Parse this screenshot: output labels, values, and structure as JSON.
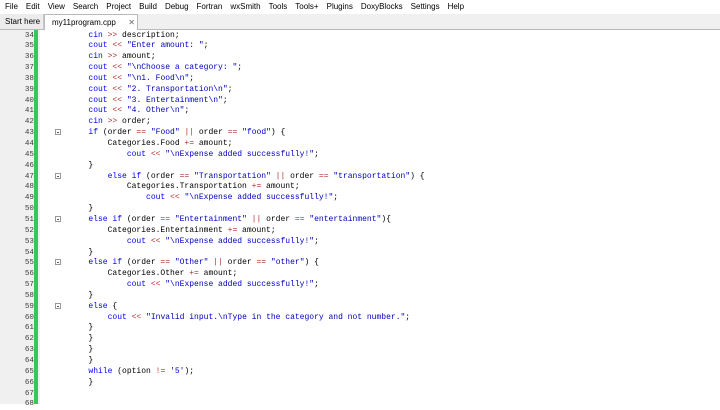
{
  "menu": [
    "File",
    "Edit",
    "View",
    "Search",
    "Project",
    "Build",
    "Debug",
    "Fortran",
    "wxSmith",
    "Tools",
    "Tools+",
    "Plugins",
    "DoxyBlocks",
    "Settings",
    "Help"
  ],
  "tabs": [
    {
      "label": "Start here",
      "active": false
    },
    {
      "label": "my11program.cpp",
      "active": true
    }
  ],
  "colors": {
    "keyword": "#0000ff",
    "string": "#0000c0",
    "operator": "#b03030",
    "changed_bar": "#34c759"
  },
  "icons": {
    "tab_close": "close-icon",
    "fold": "fold-marker-icon"
  },
  "code": [
    {
      "n": "34",
      "fold": false,
      "segs": [
        [
          "p",
          "        "
        ],
        [
          "k",
          "cin"
        ],
        [
          "p",
          " "
        ],
        [
          "o",
          ">>"
        ],
        [
          "p",
          " description;"
        ]
      ]
    },
    {
      "n": "35",
      "fold": false,
      "segs": [
        [
          "p",
          "        "
        ],
        [
          "k",
          "cout"
        ],
        [
          "p",
          " "
        ],
        [
          "o",
          "<<"
        ],
        [
          "p",
          " "
        ],
        [
          "s",
          "\"Enter amount: \""
        ],
        [
          "p",
          ";"
        ]
      ]
    },
    {
      "n": "36",
      "fold": false,
      "segs": [
        [
          "p",
          "        "
        ],
        [
          "k",
          "cin"
        ],
        [
          "p",
          " "
        ],
        [
          "o",
          ">>"
        ],
        [
          "p",
          " amount;"
        ]
      ]
    },
    {
      "n": "37",
      "fold": false,
      "segs": [
        [
          "p",
          "        "
        ],
        [
          "k",
          "cout"
        ],
        [
          "p",
          " "
        ],
        [
          "o",
          "<<"
        ],
        [
          "p",
          " "
        ],
        [
          "s",
          "\"\\nChoose a category: \""
        ],
        [
          "p",
          ";"
        ]
      ]
    },
    {
      "n": "38",
      "fold": false,
      "segs": [
        [
          "p",
          "        "
        ],
        [
          "k",
          "cout"
        ],
        [
          "p",
          " "
        ],
        [
          "o",
          "<<"
        ],
        [
          "p",
          " "
        ],
        [
          "s",
          "\"\\n1. Food\\n\""
        ],
        [
          "p",
          ";"
        ]
      ]
    },
    {
      "n": "39",
      "fold": false,
      "segs": [
        [
          "p",
          "        "
        ],
        [
          "k",
          "cout"
        ],
        [
          "p",
          " "
        ],
        [
          "o",
          "<<"
        ],
        [
          "p",
          " "
        ],
        [
          "s",
          "\"2. Transportation\\n\""
        ],
        [
          "p",
          ";"
        ]
      ]
    },
    {
      "n": "40",
      "fold": false,
      "segs": [
        [
          "p",
          "        "
        ],
        [
          "k",
          "cout"
        ],
        [
          "p",
          " "
        ],
        [
          "o",
          "<<"
        ],
        [
          "p",
          " "
        ],
        [
          "s",
          "\"3. Entertainment\\n\""
        ],
        [
          "p",
          ";"
        ]
      ]
    },
    {
      "n": "41",
      "fold": false,
      "segs": [
        [
          "p",
          "        "
        ],
        [
          "k",
          "cout"
        ],
        [
          "p",
          " "
        ],
        [
          "o",
          "<<"
        ],
        [
          "p",
          " "
        ],
        [
          "s",
          "\"4. Other\\n\""
        ],
        [
          "p",
          ";"
        ]
      ]
    },
    {
      "n": "42",
      "fold": false,
      "segs": [
        [
          "p",
          "        "
        ],
        [
          "k",
          "cin"
        ],
        [
          "p",
          " "
        ],
        [
          "o",
          ">>"
        ],
        [
          "p",
          " order;"
        ]
      ]
    },
    {
      "n": "43",
      "fold": true,
      "segs": [
        [
          "p",
          "        "
        ],
        [
          "k",
          "if"
        ],
        [
          "p",
          " (order "
        ],
        [
          "o",
          "=="
        ],
        [
          "p",
          " "
        ],
        [
          "s",
          "\"Food\""
        ],
        [
          "p",
          " "
        ],
        [
          "o",
          "||"
        ],
        [
          "p",
          " order "
        ],
        [
          "o",
          "=="
        ],
        [
          "p",
          " "
        ],
        [
          "s",
          "\"food\""
        ],
        [
          "p",
          ") {"
        ]
      ]
    },
    {
      "n": "44",
      "fold": false,
      "segs": [
        [
          "p",
          "            Categories.Food "
        ],
        [
          "o",
          "+="
        ],
        [
          "p",
          " amount;"
        ]
      ]
    },
    {
      "n": "45",
      "fold": false,
      "segs": [
        [
          "p",
          "                "
        ],
        [
          "k",
          "cout"
        ],
        [
          "p",
          " "
        ],
        [
          "o",
          "<<"
        ],
        [
          "p",
          " "
        ],
        [
          "s",
          "\"\\nExpense added successfully!\""
        ],
        [
          "p",
          ";"
        ]
      ]
    },
    {
      "n": "46",
      "fold": false,
      "segs": [
        [
          "p",
          "        }"
        ]
      ]
    },
    {
      "n": "47",
      "fold": true,
      "segs": [
        [
          "p",
          "            "
        ],
        [
          "k",
          "else if"
        ],
        [
          "p",
          " (order "
        ],
        [
          "o",
          "=="
        ],
        [
          "p",
          " "
        ],
        [
          "s",
          "\"Transportation\""
        ],
        [
          "p",
          " "
        ],
        [
          "o",
          "||"
        ],
        [
          "p",
          " order "
        ],
        [
          "o",
          "=="
        ],
        [
          "p",
          " "
        ],
        [
          "s",
          "\"transportation\""
        ],
        [
          "p",
          ") {"
        ]
      ]
    },
    {
      "n": "48",
      "fold": false,
      "segs": [
        [
          "p",
          "                Categories.Transportation "
        ],
        [
          "o",
          "+="
        ],
        [
          "p",
          " amount;"
        ]
      ]
    },
    {
      "n": "49",
      "fold": false,
      "segs": [
        [
          "p",
          "                    "
        ],
        [
          "k",
          "cout"
        ],
        [
          "p",
          " "
        ],
        [
          "o",
          "<<"
        ],
        [
          "p",
          " "
        ],
        [
          "s",
          "\"\\nExpense added successfully!\""
        ],
        [
          "p",
          ";"
        ]
      ]
    },
    {
      "n": "50",
      "fold": false,
      "segs": [
        [
          "p",
          "        }"
        ]
      ]
    },
    {
      "n": "51",
      "fold": true,
      "segs": [
        [
          "p",
          "        "
        ],
        [
          "k",
          "else if"
        ],
        [
          "p",
          " (order "
        ],
        [
          "o",
          "=="
        ],
        [
          "p",
          " "
        ],
        [
          "s",
          "\"Entertainment\""
        ],
        [
          "p",
          " "
        ],
        [
          "o",
          "||"
        ],
        [
          "p",
          " order "
        ],
        [
          "o",
          "=="
        ],
        [
          "p",
          " "
        ],
        [
          "s",
          "\"entertainment\""
        ],
        [
          "p",
          "){"
        ]
      ]
    },
    {
      "n": "52",
      "fold": false,
      "segs": [
        [
          "p",
          "            Categories.Entertainment "
        ],
        [
          "o",
          "+="
        ],
        [
          "p",
          " amount;"
        ]
      ]
    },
    {
      "n": "53",
      "fold": false,
      "segs": [
        [
          "p",
          "                "
        ],
        [
          "k",
          "cout"
        ],
        [
          "p",
          " "
        ],
        [
          "o",
          "<<"
        ],
        [
          "p",
          " "
        ],
        [
          "s",
          "\"\\nExpense added successfully!\""
        ],
        [
          "p",
          ";"
        ]
      ]
    },
    {
      "n": "54",
      "fold": false,
      "segs": [
        [
          "p",
          "        }"
        ]
      ]
    },
    {
      "n": "55",
      "fold": true,
      "segs": [
        [
          "p",
          "        "
        ],
        [
          "k",
          "else if"
        ],
        [
          "p",
          " (order "
        ],
        [
          "o",
          "=="
        ],
        [
          "p",
          " "
        ],
        [
          "s",
          "\"Other\""
        ],
        [
          "p",
          " "
        ],
        [
          "o",
          "||"
        ],
        [
          "p",
          " order "
        ],
        [
          "o",
          "=="
        ],
        [
          "p",
          " "
        ],
        [
          "s",
          "\"other\""
        ],
        [
          "p",
          ") {"
        ]
      ]
    },
    {
      "n": "56",
      "fold": false,
      "segs": [
        [
          "p",
          "            Categories.Other "
        ],
        [
          "o",
          "+="
        ],
        [
          "p",
          " amount;"
        ]
      ]
    },
    {
      "n": "57",
      "fold": false,
      "segs": [
        [
          "p",
          "                "
        ],
        [
          "k",
          "cout"
        ],
        [
          "p",
          " "
        ],
        [
          "o",
          "<<"
        ],
        [
          "p",
          " "
        ],
        [
          "s",
          "\"\\nExpense added successfully!\""
        ],
        [
          "p",
          ";"
        ]
      ]
    },
    {
      "n": "58",
      "fold": false,
      "segs": [
        [
          "p",
          "        }"
        ]
      ]
    },
    {
      "n": "59",
      "fold": true,
      "segs": [
        [
          "p",
          "        "
        ],
        [
          "k",
          "else"
        ],
        [
          "p",
          " {"
        ]
      ]
    },
    {
      "n": "60",
      "fold": false,
      "segs": [
        [
          "p",
          "            "
        ],
        [
          "k",
          "cout"
        ],
        [
          "p",
          " "
        ],
        [
          "o",
          "<<"
        ],
        [
          "p",
          " "
        ],
        [
          "s",
          "\"Invalid input.\\nType in the category and not number.\""
        ],
        [
          "p",
          ";"
        ]
      ]
    },
    {
      "n": "61",
      "fold": false,
      "segs": [
        [
          "p",
          "        }"
        ]
      ]
    },
    {
      "n": "62",
      "fold": false,
      "segs": [
        [
          "p",
          "        }"
        ]
      ]
    },
    {
      "n": "63",
      "fold": false,
      "segs": [
        [
          "p",
          "        }"
        ]
      ]
    },
    {
      "n": "64",
      "fold": false,
      "segs": [
        [
          "p",
          "        }"
        ]
      ]
    },
    {
      "n": "65",
      "fold": false,
      "segs": [
        [
          "p",
          "        "
        ],
        [
          "k",
          "while"
        ],
        [
          "p",
          " (option "
        ],
        [
          "o",
          "!="
        ],
        [
          "p",
          " "
        ],
        [
          "s",
          "'5'"
        ],
        [
          "p",
          ");"
        ]
      ]
    },
    {
      "n": "66",
      "fold": false,
      "segs": [
        [
          "p",
          "        }"
        ]
      ]
    },
    {
      "n": "67",
      "fold": false,
      "segs": []
    },
    {
      "n": "68",
      "fold": false,
      "segs": []
    }
  ]
}
